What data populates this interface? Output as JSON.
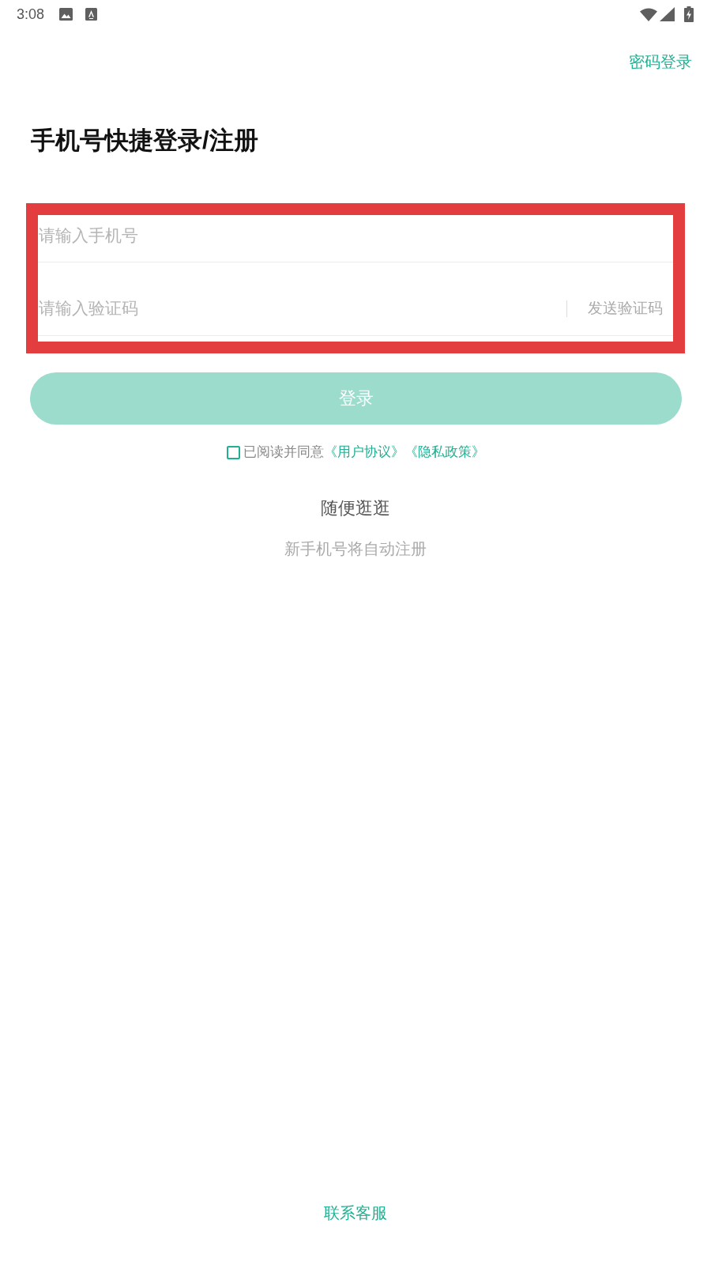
{
  "status_bar": {
    "time": "3:08"
  },
  "header": {
    "password_login_link": "密码登录"
  },
  "title": "手机号快捷登录/注册",
  "form": {
    "phone_field": {
      "placeholder": "请输入手机号"
    },
    "code_field": {
      "placeholder": "请输入验证码"
    },
    "send_code_button": "发送验证码"
  },
  "login_button": {
    "label": "登录",
    "disabled": true
  },
  "agreement": {
    "checked": false,
    "text": "已阅读并同意",
    "links": [
      "《用户协议》",
      "《隐私政策》"
    ]
  },
  "browse_link": "随便逛逛",
  "hint": "新手机号将自动注册",
  "contact_link": "联系客服"
}
